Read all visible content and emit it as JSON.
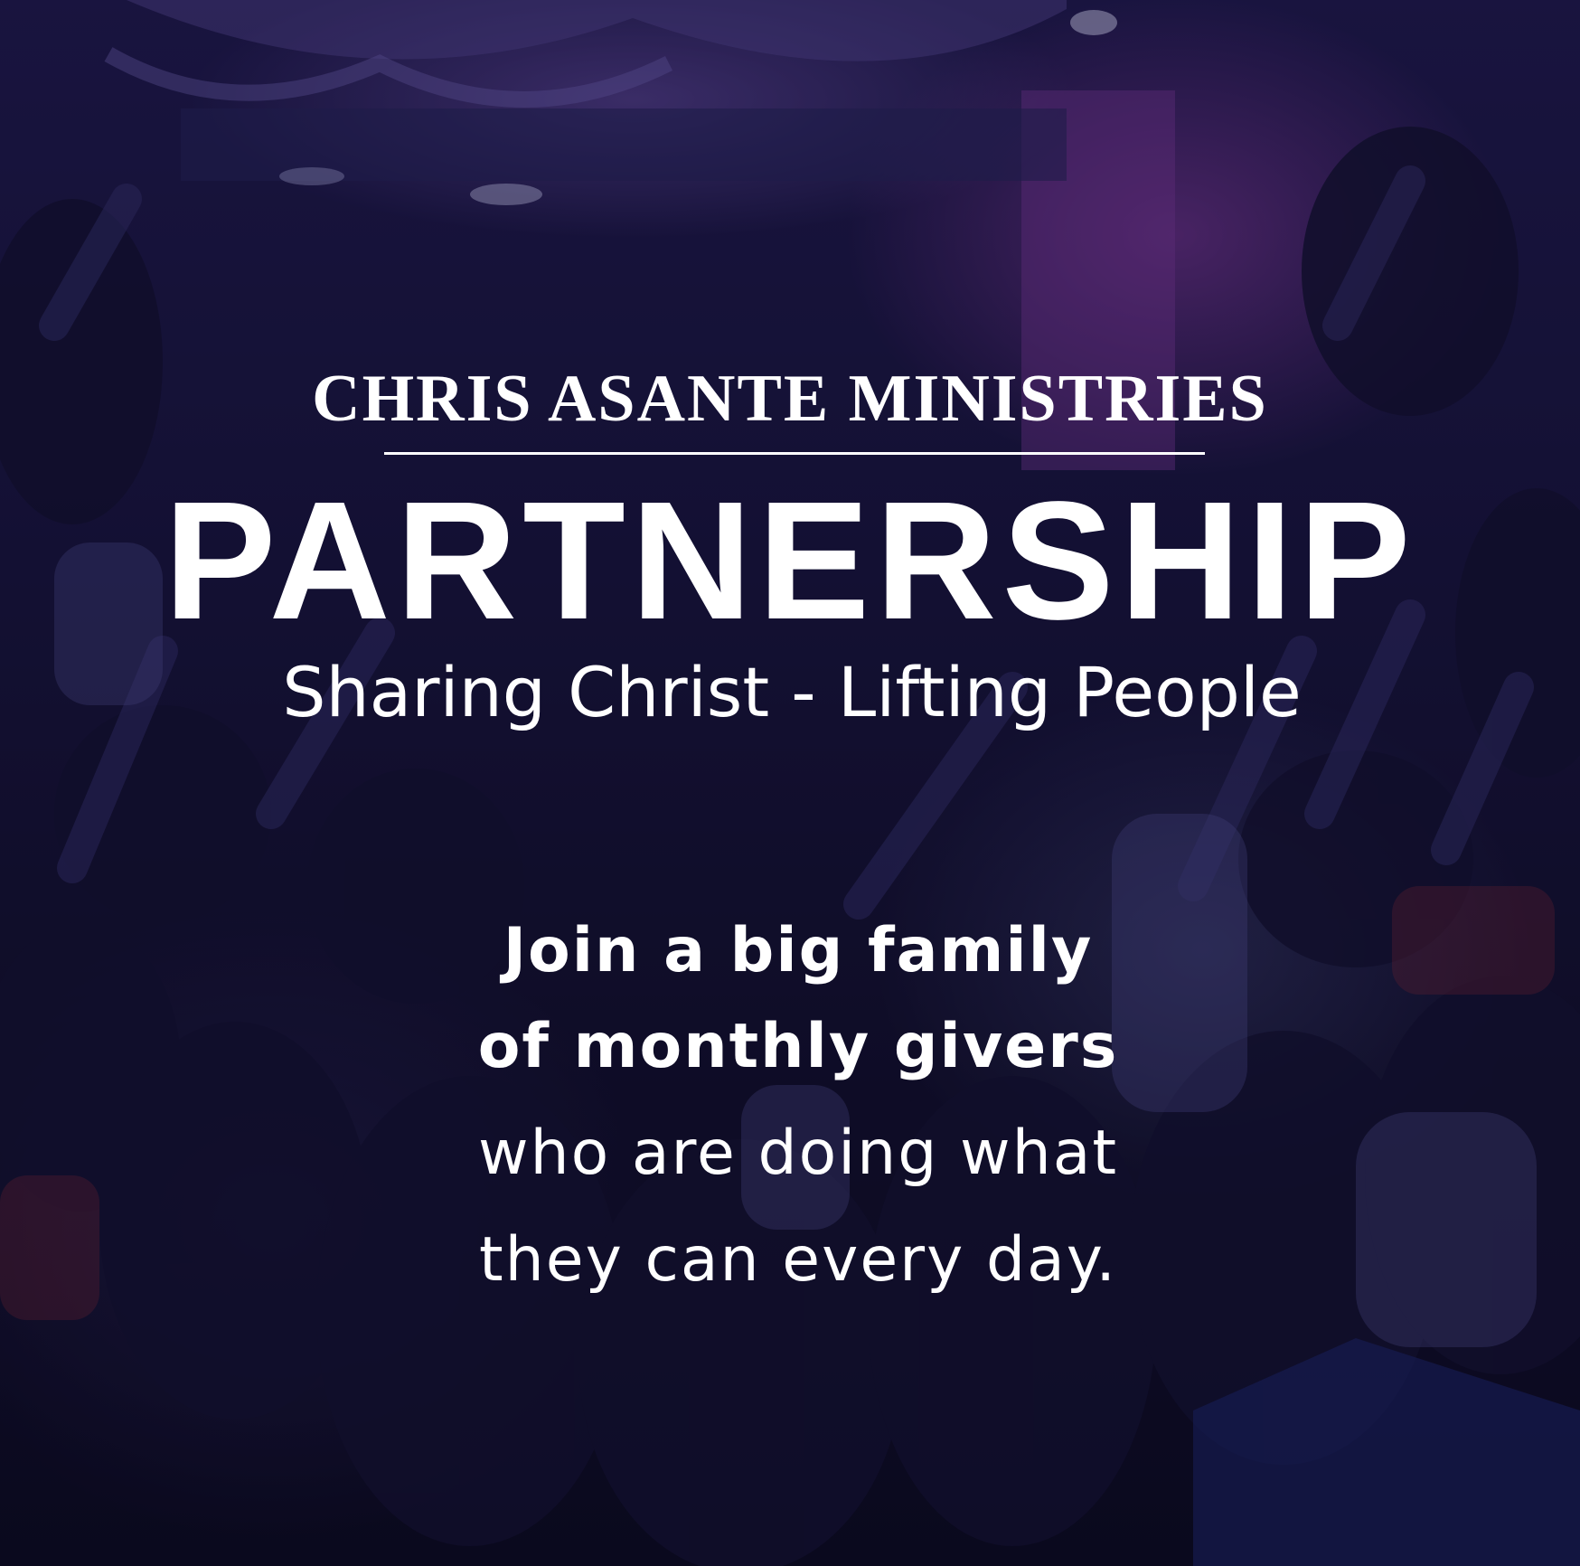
{
  "ministry": {
    "name": "CHRIS ASANTE MINISTRIES"
  },
  "headline": "PARTNERSHIP",
  "tagline": "Sharing Christ - Lifting People",
  "pitch": {
    "lines": [
      "Join a big family",
      "of monthly givers",
      "who are doing what",
      "they can every day."
    ]
  },
  "colors": {
    "text": "#ffffff",
    "background_tint": "#1a1540",
    "stage_light": "#aa46be"
  }
}
